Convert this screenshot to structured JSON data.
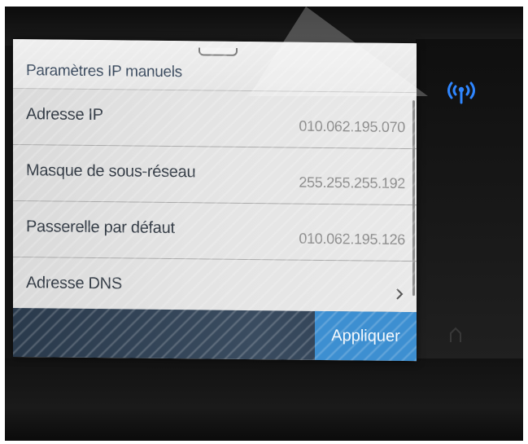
{
  "screen": {
    "title": "Paramètres IP manuels",
    "rows": [
      {
        "label": "Adresse IP",
        "value": "010.062.195.070"
      },
      {
        "label": "Masque de sous-réseau",
        "value": "255.255.255.192"
      },
      {
        "label": "Passerelle par défaut",
        "value": "010.062.195.126"
      },
      {
        "label": "Adresse DNS"
      }
    ],
    "apply_label": "Appliquer"
  },
  "icons": {
    "wireless": "wireless-signal-icon",
    "row_arrow": "chevron-right-icon",
    "home": "home-icon"
  },
  "colors": {
    "accent": "#3d8fd1",
    "wireless": "#2f86ff"
  }
}
